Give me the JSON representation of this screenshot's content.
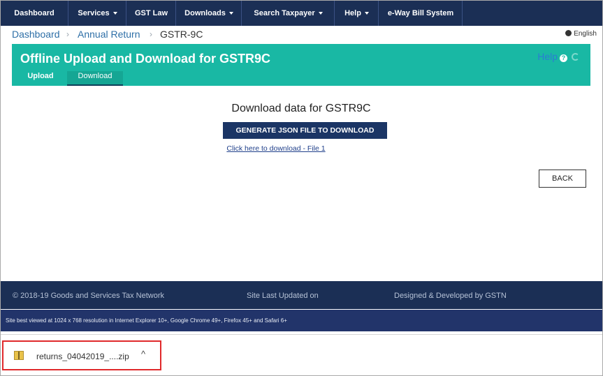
{
  "nav": {
    "items": [
      {
        "label": "Dashboard",
        "dropdown": false
      },
      {
        "label": "Services",
        "dropdown": true
      },
      {
        "label": "GST Law",
        "dropdown": false
      },
      {
        "label": "Downloads",
        "dropdown": true
      },
      {
        "label": "Search Taxpayer",
        "dropdown": true
      },
      {
        "label": "Help",
        "dropdown": true
      },
      {
        "label": "e-Way Bill System",
        "dropdown": false
      }
    ]
  },
  "breadcrumb": {
    "items": [
      "Dashboard",
      "Annual Return",
      "GSTR-9C"
    ],
    "language": "English"
  },
  "header": {
    "title": "Offline Upload and Download for GSTR9C",
    "help_label": "Help",
    "tabs": [
      {
        "label": "Upload",
        "active": false
      },
      {
        "label": "Download",
        "active": true
      }
    ]
  },
  "main": {
    "heading": "Download data for GSTR9C",
    "generate_button": "GENERATE JSON FILE TO DOWNLOAD",
    "download_link": "Click here to download - File 1",
    "back_button": "BACK"
  },
  "footer": {
    "copyright": "© 2018-19 Goods and Services Tax Network",
    "last_updated": "Site Last Updated on",
    "designed_by": "Designed & Developed by GSTN",
    "best_viewed": "Site best viewed at 1024 x 768 resolution in Internet Explorer 10+, Google Chrome 49+, Firefox 45+ and Safari 6+"
  },
  "download_bar": {
    "file_name": "returns_04042019_....zip",
    "icon": "zip-file-icon"
  },
  "colors": {
    "nav_bg": "#1b2f55",
    "teal_header": "#19b8a4",
    "primary_button": "#1b3565",
    "highlight_border": "#e0292b"
  }
}
